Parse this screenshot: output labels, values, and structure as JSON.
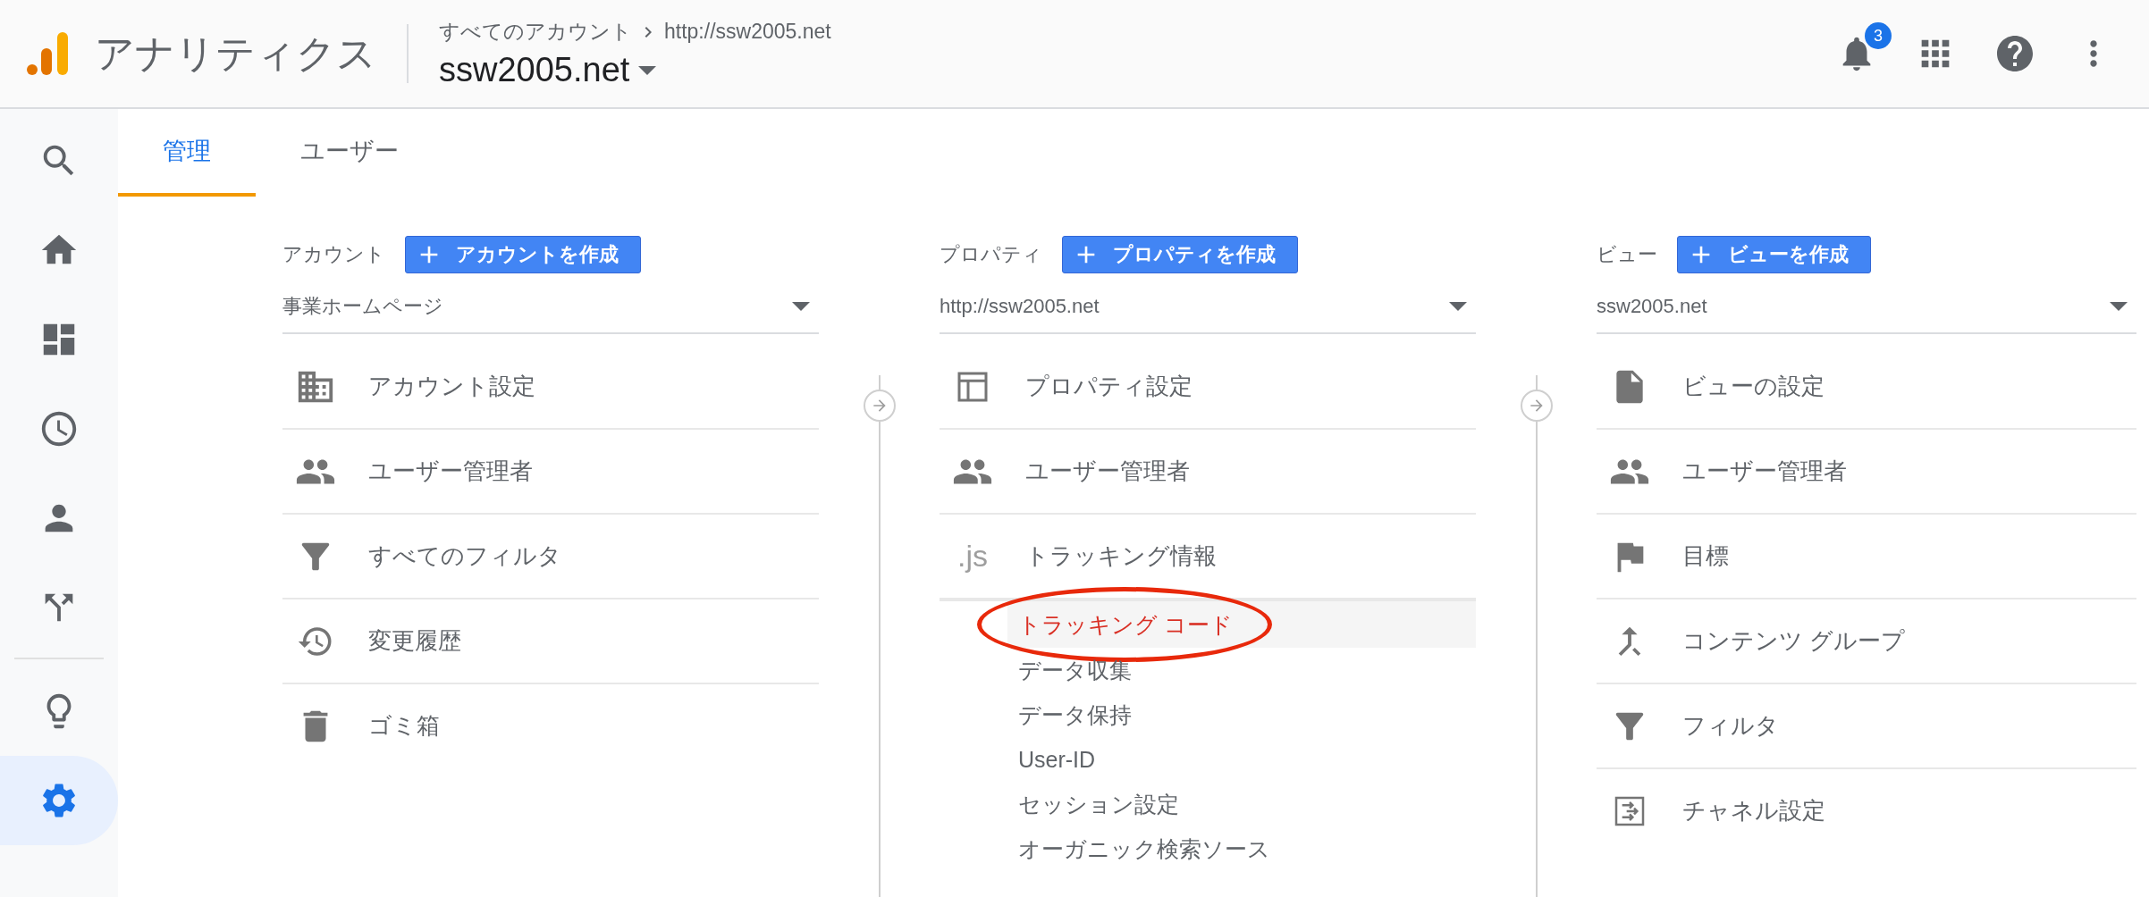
{
  "header": {
    "product": "アナリティクス",
    "breadcrumb": [
      "すべてのアカウント",
      "http://ssw2005.net"
    ],
    "property_name": "ssw2005.net",
    "notifications": "3"
  },
  "sidebar": {
    "items": [
      {
        "kind": "search",
        "selected": false
      },
      {
        "kind": "home",
        "selected": false
      },
      {
        "kind": "dashboard",
        "selected": false
      },
      {
        "kind": "clock",
        "selected": false
      },
      {
        "kind": "person",
        "selected": false
      },
      {
        "kind": "flow",
        "selected": false
      },
      {
        "kind": "bulb",
        "selected": false
      },
      {
        "kind": "settings",
        "selected": true
      }
    ]
  },
  "tabs": [
    {
      "label": "管理",
      "selected": true
    },
    {
      "label": "ユーザー",
      "selected": false
    }
  ],
  "columns": [
    {
      "label": "アカウント",
      "create_button": "アカウントを作成",
      "selector": "事業ホームページ",
      "items": [
        {
          "kind": "building",
          "label": "アカウント設定"
        },
        {
          "kind": "people",
          "label": "ユーザー管理者"
        },
        {
          "kind": "filter",
          "label": "すべてのフィルタ"
        },
        {
          "kind": "history",
          "label": "変更履歴"
        },
        {
          "kind": "trash",
          "label": "ゴミ箱"
        }
      ]
    },
    {
      "label": "プロパティ",
      "create_button": "プロパティを作成",
      "selector": "http://ssw2005.net",
      "items": [
        {
          "kind": "layout",
          "label": "プロパティ設定"
        },
        {
          "kind": "people",
          "label": "ユーザー管理者"
        },
        {
          "kind": "js",
          "icon_text": ".js",
          "label": "トラッキング情報",
          "expanded": true,
          "children": [
            {
              "label": "トラッキング コード",
              "selected": true,
              "circled": true
            },
            {
              "label": "データ収集",
              "selected": false,
              "circled": false
            },
            {
              "label": "データ保持",
              "selected": false,
              "circled": false
            },
            {
              "label": "User-ID",
              "selected": false,
              "circled": false
            },
            {
              "label": "セッション設定",
              "selected": false,
              "circled": false
            },
            {
              "label": "オーガニック検索ソース",
              "selected": false,
              "circled": false
            }
          ]
        }
      ]
    },
    {
      "label": "ビュー",
      "create_button": "ビューを作成",
      "selector": "ssw2005.net",
      "items": [
        {
          "kind": "document",
          "label": "ビューの設定"
        },
        {
          "kind": "people",
          "label": "ユーザー管理者"
        },
        {
          "kind": "flag",
          "label": "目標"
        },
        {
          "kind": "merge",
          "label": "コンテンツ グループ"
        },
        {
          "kind": "filter",
          "label": "フィルタ"
        },
        {
          "kind": "channel",
          "label": "チャネル設定"
        }
      ]
    }
  ]
}
